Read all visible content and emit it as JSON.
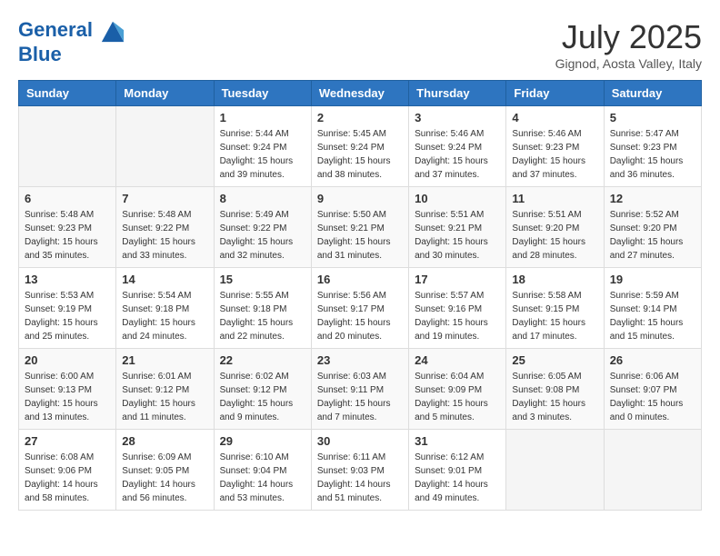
{
  "header": {
    "logo_line1": "General",
    "logo_line2": "Blue",
    "month": "July 2025",
    "location": "Gignod, Aosta Valley, Italy"
  },
  "weekdays": [
    "Sunday",
    "Monday",
    "Tuesday",
    "Wednesday",
    "Thursday",
    "Friday",
    "Saturday"
  ],
  "weeks": [
    [
      {
        "day": "",
        "empty": true
      },
      {
        "day": "",
        "empty": true
      },
      {
        "day": "1",
        "sunrise": "5:44 AM",
        "sunset": "9:24 PM",
        "daylight": "15 hours and 39 minutes."
      },
      {
        "day": "2",
        "sunrise": "5:45 AM",
        "sunset": "9:24 PM",
        "daylight": "15 hours and 38 minutes."
      },
      {
        "day": "3",
        "sunrise": "5:46 AM",
        "sunset": "9:24 PM",
        "daylight": "15 hours and 37 minutes."
      },
      {
        "day": "4",
        "sunrise": "5:46 AM",
        "sunset": "9:23 PM",
        "daylight": "15 hours and 37 minutes."
      },
      {
        "day": "5",
        "sunrise": "5:47 AM",
        "sunset": "9:23 PM",
        "daylight": "15 hours and 36 minutes."
      }
    ],
    [
      {
        "day": "6",
        "sunrise": "5:48 AM",
        "sunset": "9:23 PM",
        "daylight": "15 hours and 35 minutes."
      },
      {
        "day": "7",
        "sunrise": "5:48 AM",
        "sunset": "9:22 PM",
        "daylight": "15 hours and 33 minutes."
      },
      {
        "day": "8",
        "sunrise": "5:49 AM",
        "sunset": "9:22 PM",
        "daylight": "15 hours and 32 minutes."
      },
      {
        "day": "9",
        "sunrise": "5:50 AM",
        "sunset": "9:21 PM",
        "daylight": "15 hours and 31 minutes."
      },
      {
        "day": "10",
        "sunrise": "5:51 AM",
        "sunset": "9:21 PM",
        "daylight": "15 hours and 30 minutes."
      },
      {
        "day": "11",
        "sunrise": "5:51 AM",
        "sunset": "9:20 PM",
        "daylight": "15 hours and 28 minutes."
      },
      {
        "day": "12",
        "sunrise": "5:52 AM",
        "sunset": "9:20 PM",
        "daylight": "15 hours and 27 minutes."
      }
    ],
    [
      {
        "day": "13",
        "sunrise": "5:53 AM",
        "sunset": "9:19 PM",
        "daylight": "15 hours and 25 minutes."
      },
      {
        "day": "14",
        "sunrise": "5:54 AM",
        "sunset": "9:18 PM",
        "daylight": "15 hours and 24 minutes."
      },
      {
        "day": "15",
        "sunrise": "5:55 AM",
        "sunset": "9:18 PM",
        "daylight": "15 hours and 22 minutes."
      },
      {
        "day": "16",
        "sunrise": "5:56 AM",
        "sunset": "9:17 PM",
        "daylight": "15 hours and 20 minutes."
      },
      {
        "day": "17",
        "sunrise": "5:57 AM",
        "sunset": "9:16 PM",
        "daylight": "15 hours and 19 minutes."
      },
      {
        "day": "18",
        "sunrise": "5:58 AM",
        "sunset": "9:15 PM",
        "daylight": "15 hours and 17 minutes."
      },
      {
        "day": "19",
        "sunrise": "5:59 AM",
        "sunset": "9:14 PM",
        "daylight": "15 hours and 15 minutes."
      }
    ],
    [
      {
        "day": "20",
        "sunrise": "6:00 AM",
        "sunset": "9:13 PM",
        "daylight": "15 hours and 13 minutes."
      },
      {
        "day": "21",
        "sunrise": "6:01 AM",
        "sunset": "9:12 PM",
        "daylight": "15 hours and 11 minutes."
      },
      {
        "day": "22",
        "sunrise": "6:02 AM",
        "sunset": "9:12 PM",
        "daylight": "15 hours and 9 minutes."
      },
      {
        "day": "23",
        "sunrise": "6:03 AM",
        "sunset": "9:11 PM",
        "daylight": "15 hours and 7 minutes."
      },
      {
        "day": "24",
        "sunrise": "6:04 AM",
        "sunset": "9:09 PM",
        "daylight": "15 hours and 5 minutes."
      },
      {
        "day": "25",
        "sunrise": "6:05 AM",
        "sunset": "9:08 PM",
        "daylight": "15 hours and 3 minutes."
      },
      {
        "day": "26",
        "sunrise": "6:06 AM",
        "sunset": "9:07 PM",
        "daylight": "15 hours and 0 minutes."
      }
    ],
    [
      {
        "day": "27",
        "sunrise": "6:08 AM",
        "sunset": "9:06 PM",
        "daylight": "14 hours and 58 minutes."
      },
      {
        "day": "28",
        "sunrise": "6:09 AM",
        "sunset": "9:05 PM",
        "daylight": "14 hours and 56 minutes."
      },
      {
        "day": "29",
        "sunrise": "6:10 AM",
        "sunset": "9:04 PM",
        "daylight": "14 hours and 53 minutes."
      },
      {
        "day": "30",
        "sunrise": "6:11 AM",
        "sunset": "9:03 PM",
        "daylight": "14 hours and 51 minutes."
      },
      {
        "day": "31",
        "sunrise": "6:12 AM",
        "sunset": "9:01 PM",
        "daylight": "14 hours and 49 minutes."
      },
      {
        "day": "",
        "empty": true
      },
      {
        "day": "",
        "empty": true
      }
    ]
  ]
}
